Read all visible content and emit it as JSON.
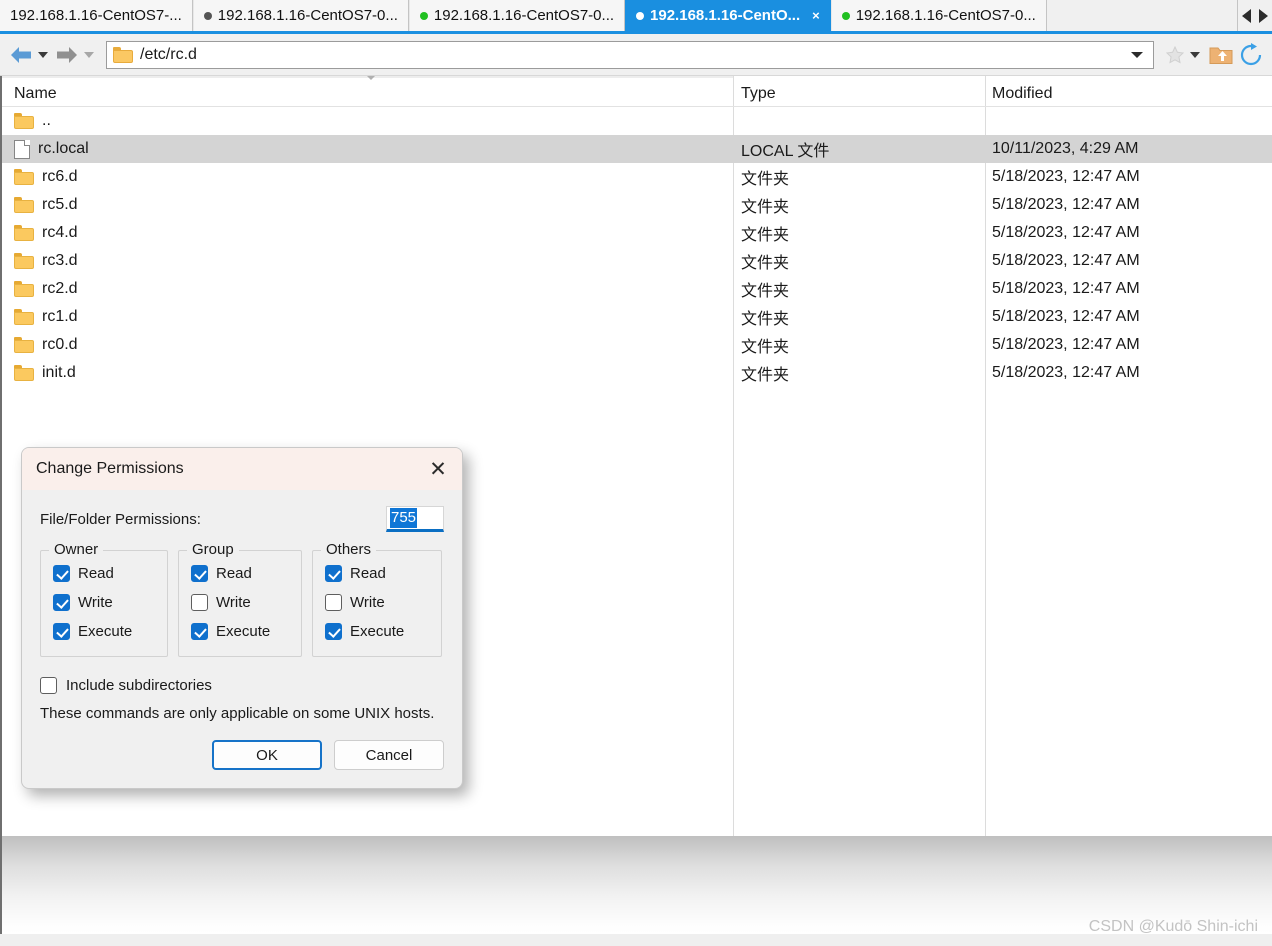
{
  "tabs": {
    "items": [
      {
        "label": "192.168.1.16-CentOS7-...",
        "dot": "none",
        "active": false,
        "closable": false
      },
      {
        "label": "192.168.1.16-CentOS7-0...",
        "dot": "gray",
        "active": false,
        "closable": false
      },
      {
        "label": "192.168.1.16-CentOS7-0...",
        "dot": "green",
        "active": false,
        "closable": false
      },
      {
        "label": "192.168.1.16-CentO...",
        "dot": "white",
        "active": true,
        "closable": true
      },
      {
        "label": "192.168.1.16-CentOS7-0...",
        "dot": "green",
        "active": false,
        "closable": false
      }
    ],
    "close_glyph": "×",
    "scroll_left_name": "scroll-tabs-left",
    "scroll_right_name": "scroll-tabs-right",
    "active_color": "#1a8fe0",
    "dot_green": "#21c021",
    "dot_gray": "#555555"
  },
  "toolbar": {
    "back_label": "Back",
    "forward_label": "Forward",
    "address_value": "/etc/rc.d",
    "address_placeholder": "",
    "favorites_label": "Favorites",
    "parent_label": "Up one level",
    "refresh_label": "Refresh"
  },
  "filelist": {
    "columns": [
      "Name",
      "Type",
      "Modified"
    ],
    "sort_column": "Name",
    "sort_direction": "descending",
    "rows": [
      {
        "name": "..",
        "icon": "folder-icon",
        "type": "",
        "modified": "",
        "selected": false
      },
      {
        "name": "rc.local",
        "icon": "file-icon",
        "type": "LOCAL 文件",
        "modified": "10/11/2023, 4:29 AM",
        "selected": true
      },
      {
        "name": "rc6.d",
        "icon": "folder-icon",
        "type": "文件夹",
        "modified": "5/18/2023, 12:47 AM",
        "selected": false
      },
      {
        "name": "rc5.d",
        "icon": "folder-icon",
        "type": "文件夹",
        "modified": "5/18/2023, 12:47 AM",
        "selected": false
      },
      {
        "name": "rc4.d",
        "icon": "folder-icon",
        "type": "文件夹",
        "modified": "5/18/2023, 12:47 AM",
        "selected": false
      },
      {
        "name": "rc3.d",
        "icon": "folder-icon",
        "type": "文件夹",
        "modified": "5/18/2023, 12:47 AM",
        "selected": false
      },
      {
        "name": "rc2.d",
        "icon": "folder-icon",
        "type": "文件夹",
        "modified": "5/18/2023, 12:47 AM",
        "selected": false
      },
      {
        "name": "rc1.d",
        "icon": "folder-icon",
        "type": "文件夹",
        "modified": "5/18/2023, 12:47 AM",
        "selected": false
      },
      {
        "name": "rc0.d",
        "icon": "folder-icon",
        "type": "文件夹",
        "modified": "5/18/2023, 12:47 AM",
        "selected": false
      },
      {
        "name": "init.d",
        "icon": "folder-icon",
        "type": "文件夹",
        "modified": "5/18/2023, 12:47 AM",
        "selected": false
      }
    ]
  },
  "dialog": {
    "title": "Change Permissions",
    "close_glyph": "✕",
    "permissions_label": "File/Folder Permissions:",
    "permissions_value": "755",
    "groups": [
      {
        "legend": "Owner",
        "checks": [
          {
            "label": "Read",
            "checked": true
          },
          {
            "label": "Write",
            "checked": true
          },
          {
            "label": "Execute",
            "checked": true
          }
        ]
      },
      {
        "legend": "Group",
        "checks": [
          {
            "label": "Read",
            "checked": true
          },
          {
            "label": "Write",
            "checked": false
          },
          {
            "label": "Execute",
            "checked": true
          }
        ]
      },
      {
        "legend": "Others",
        "checks": [
          {
            "label": "Read",
            "checked": true
          },
          {
            "label": "Write",
            "checked": false
          },
          {
            "label": "Execute",
            "checked": true
          }
        ]
      }
    ],
    "include_subdirectories": {
      "label": "Include subdirectories",
      "checked": false
    },
    "note": "These commands are only applicable on some UNIX hosts.",
    "ok_label": "OK",
    "cancel_label": "Cancel",
    "accent_color": "#0f70cd"
  },
  "watermark": "CSDN @Kudō Shin-ichi"
}
